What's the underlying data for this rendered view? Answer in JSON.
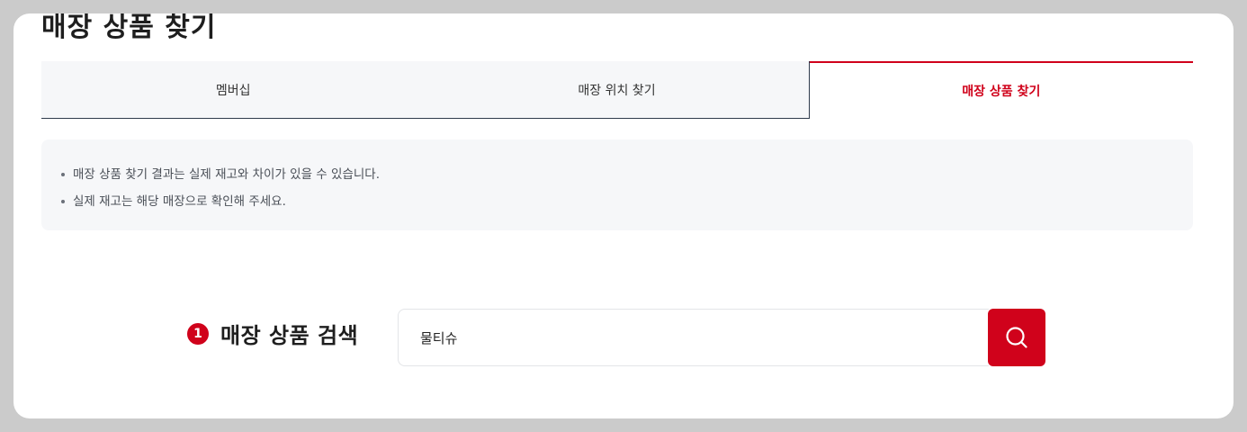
{
  "page": {
    "title": "매장 상품 찾기"
  },
  "tabs": [
    {
      "label": "멤버십",
      "active": false
    },
    {
      "label": "매장 위치 찾기",
      "active": false
    },
    {
      "label": "매장 상품 찾기",
      "active": true
    }
  ],
  "notice": {
    "items": [
      "매장 상품 찾기 결과는 실제 재고와 차이가 있을 수 있습니다.",
      "실제 재고는 해당 매장으로 확인해 주세요."
    ]
  },
  "search": {
    "step_number": "1",
    "label": "매장 상품 검색",
    "value": "물티슈",
    "button_icon": "search-icon"
  },
  "colors": {
    "accent": "#d0021b",
    "tab_border": "#2f3b4c",
    "panel_bg": "#f6f7f9"
  }
}
